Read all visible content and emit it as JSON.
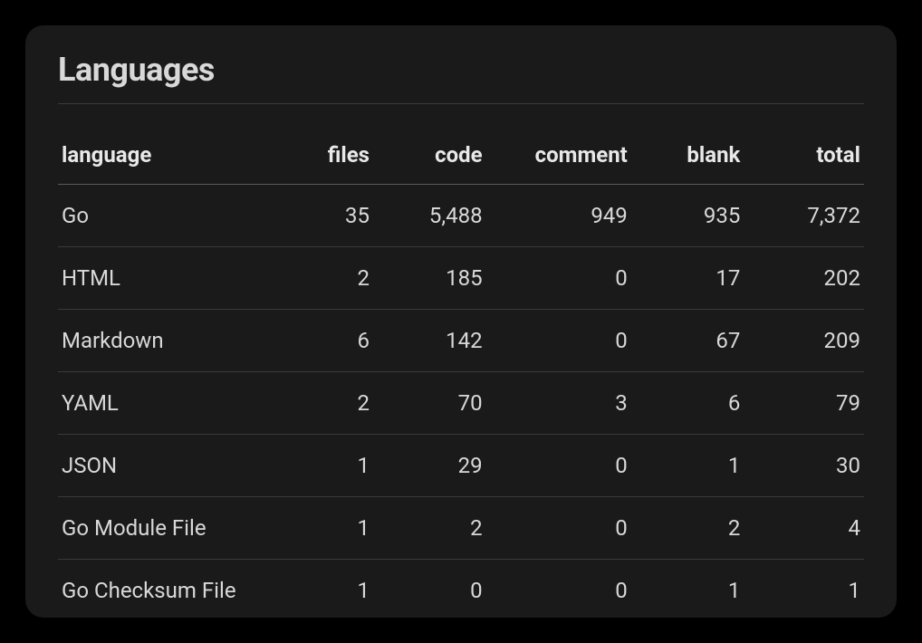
{
  "title": "Languages",
  "columns": {
    "language": "language",
    "files": "files",
    "code": "code",
    "comment": "comment",
    "blank": "blank",
    "total": "total"
  },
  "rows": [
    {
      "language": "Go",
      "files": "35",
      "code": "5,488",
      "comment": "949",
      "blank": "935",
      "total": "7,372"
    },
    {
      "language": "HTML",
      "files": "2",
      "code": "185",
      "comment": "0",
      "blank": "17",
      "total": "202"
    },
    {
      "language": "Markdown",
      "files": "6",
      "code": "142",
      "comment": "0",
      "blank": "67",
      "total": "209"
    },
    {
      "language": "YAML",
      "files": "2",
      "code": "70",
      "comment": "3",
      "blank": "6",
      "total": "79"
    },
    {
      "language": "JSON",
      "files": "1",
      "code": "29",
      "comment": "0",
      "blank": "1",
      "total": "30"
    },
    {
      "language": "Go Module File",
      "files": "1",
      "code": "2",
      "comment": "0",
      "blank": "2",
      "total": "4"
    },
    {
      "language": "Go Checksum File",
      "files": "1",
      "code": "0",
      "comment": "0",
      "blank": "1",
      "total": "1"
    }
  ]
}
